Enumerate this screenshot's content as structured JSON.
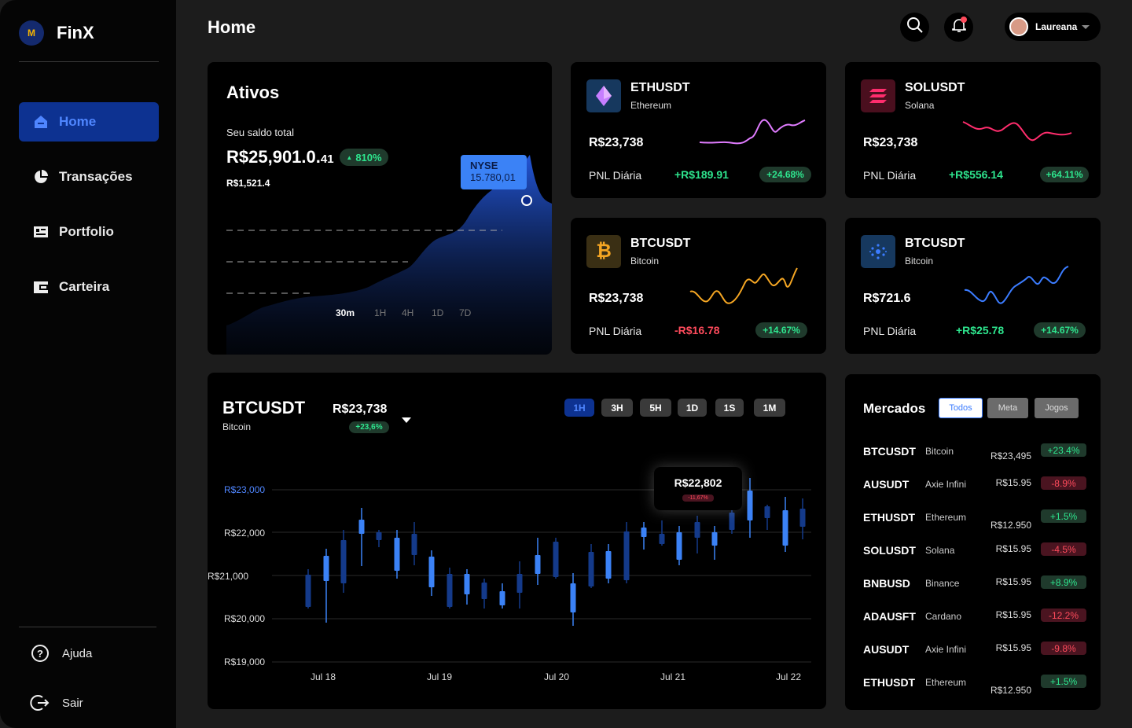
{
  "app": {
    "name": "FinX",
    "logo_mark": "M"
  },
  "sidebar": {
    "items": [
      {
        "label": "Home",
        "icon": "home-icon"
      },
      {
        "label": "Transações",
        "icon": "pie-chart-icon"
      },
      {
        "label": "Portfolio",
        "icon": "portfolio-icon"
      },
      {
        "label": "Carteira",
        "icon": "wallet-icon"
      }
    ],
    "help": "Ajuda",
    "logout": "Sair"
  },
  "header": {
    "title": "Home",
    "user": "Laureana"
  },
  "ativos": {
    "title": "Ativos",
    "saldo_label": "Seu saldo total",
    "saldo_main": "R$25,901.0.",
    "saldo_cents": "41",
    "change": "810%",
    "sub": "R$1,521.4",
    "tooltip_exchange": "NYSE",
    "tooltip_value": "15.780,01",
    "timeframes": [
      "30m",
      "1H",
      "4H",
      "1D",
      "7D"
    ],
    "active_timeframe": "30m"
  },
  "coins": [
    {
      "symbol": "ETHUSDT",
      "name": "Ethereum",
      "price": "R$23,738",
      "pnl_label": "PNL Diária",
      "pnl": "+R$189.91",
      "pct": "+24.68%",
      "color": "#e07cff"
    },
    {
      "symbol": "SOLUSDT",
      "name": "Solana",
      "price": "R$23,738",
      "pnl_label": "PNL Diária",
      "pnl": "+R$556.14",
      "pct": "+64.11%",
      "color": "#ff2d6d"
    },
    {
      "symbol": "BTCUSDT",
      "name": "Bitcoin",
      "price": "R$23,738",
      "pnl_label": "PNL Diária",
      "pnl": "-R$16.78",
      "pct": "+14.67%",
      "color": "#f5a623"
    },
    {
      "symbol": "BTCUSDT",
      "name": "Bitcoin",
      "price": "R$721.6",
      "pnl_label": "PNL Diária",
      "pnl": "+R$25.78",
      "pct": "+14.67%",
      "color": "#3b7cff"
    }
  ],
  "btc": {
    "symbol": "BTCUSDT",
    "name": "Bitcoin",
    "price": "R$23,738",
    "change": "+23,6%",
    "timeframes": [
      "1H",
      "3H",
      "5H",
      "1D",
      "1S",
      "1M"
    ],
    "tooltip_price": "R$22,802",
    "tooltip_change": "-11,67%"
  },
  "chart_data": {
    "type": "candlestick",
    "y_ticks": [
      "R$23,000",
      "R$22,000",
      "R$21,000",
      "R$20,000",
      "R$19,000"
    ],
    "x_ticks": [
      "Jul 18",
      "Jul 19",
      "Jul 20",
      "Jul 21",
      "Jul 22"
    ]
  },
  "mercados": {
    "title": "Mercados",
    "filters": [
      "Todos",
      "Meta",
      "Jogos"
    ],
    "rows": [
      {
        "symbol": "BTCUSDT",
        "name": "Bitcoin",
        "price": "R$23,495",
        "change": "+23.4%",
        "up": true
      },
      {
        "symbol": "AUSUDT",
        "name": "Axie Infini",
        "price": "R$15.95",
        "change": "-8.9%",
        "up": false
      },
      {
        "symbol": "ETHUSDT",
        "name": "Ethereum",
        "price": "R$12.950",
        "change": "+1.5%",
        "up": true
      },
      {
        "symbol": "SOLUSDT",
        "name": "Solana",
        "price": "R$15.95",
        "change": "-4.5%",
        "up": false
      },
      {
        "symbol": "BNBUSD",
        "name": "Binance",
        "price": "R$15.95",
        "change": "+8.9%",
        "up": true
      },
      {
        "symbol": "ADAUSFT",
        "name": "Cardano",
        "price": "R$15.95",
        "change": "-12.2%",
        "up": false
      },
      {
        "symbol": "AUSUDT",
        "name": "Axie Infini",
        "price": "R$15.95",
        "change": "-9.8%",
        "up": false
      },
      {
        "symbol": "ETHUSDT",
        "name": "Ethereum",
        "price": "R$12.950",
        "change": "+1.5%",
        "up": true
      }
    ]
  }
}
